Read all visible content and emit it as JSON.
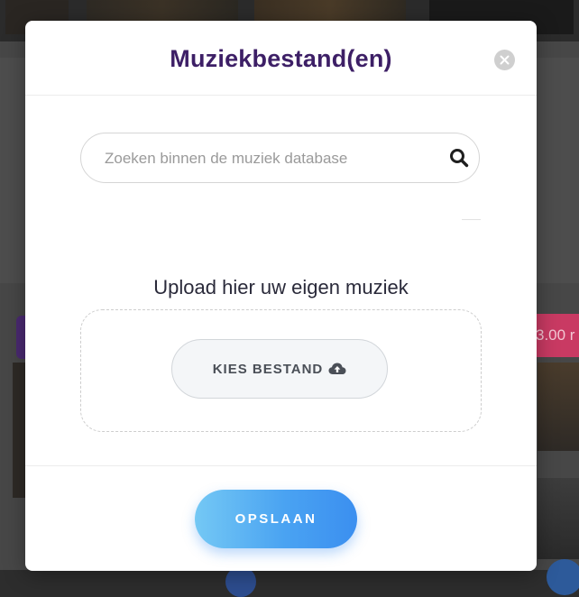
{
  "background": {
    "price_fragment": "3.00 r"
  },
  "modal": {
    "title": "Muziekbestand(en)",
    "search": {
      "placeholder": "Zoeken binnen de muziek database",
      "value": ""
    },
    "upload": {
      "heading": "Upload hier uw eigen muziek",
      "button_label": "KIES BESTAND"
    },
    "save_label": "OPSLAAN"
  },
  "colors": {
    "title": "#3d1f66",
    "save_gradient_start": "#74c8f4",
    "save_gradient_end": "#3b8ff0",
    "overlay": "#474747"
  },
  "icons": {
    "close": "close-icon",
    "search": "search-icon",
    "upload": "cloud-upload-icon"
  }
}
